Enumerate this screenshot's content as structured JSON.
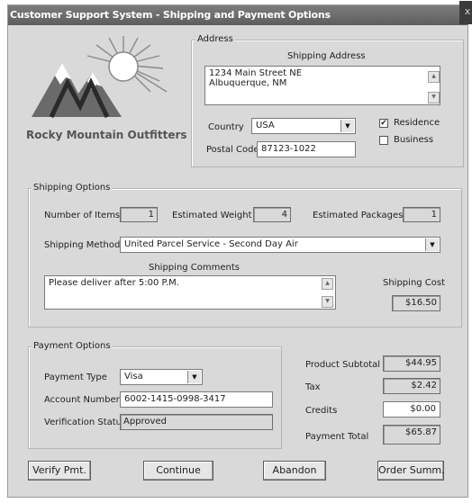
{
  "window": {
    "title": "Customer Support System - Shipping and Payment Options",
    "close_glyph": "x"
  },
  "logo": {
    "text": "Rocky Mountain Outfitters"
  },
  "address": {
    "group_title": "Address",
    "shipping_address_label": "Shipping Address",
    "shipping_address_value": "1234 Main Street  NE\nAlbuquerque, NM",
    "country_label": "Country",
    "country_value": "USA",
    "postal_code_label": "Postal Code",
    "postal_code_value": "87123-1022",
    "residence_label": "Residence",
    "residence_checked": true,
    "business_label": "Business",
    "business_checked": false
  },
  "shipping": {
    "group_title": "Shipping Options",
    "items_label": "Number of Items",
    "items_value": "1",
    "weight_label": "Estimated Weight",
    "weight_value": "4",
    "packages_label": "Estimated Packages",
    "packages_value": "1",
    "method_label": "Shipping Method",
    "method_value": "United Parcel Service - Second Day Air",
    "comments_label": "Shipping Comments",
    "comments_value": "Please deliver after 5:00 P.M.",
    "cost_label": "Shipping Cost",
    "cost_value": "$16.50"
  },
  "payment": {
    "group_title": "Payment Options",
    "type_label": "Payment Type",
    "type_value": "Visa",
    "account_label": "Account Number",
    "account_value": "6002-1415-0998-3417",
    "verification_label": "Verification Status",
    "verification_value": "Approved"
  },
  "totals": {
    "subtotal_label": "Product Subtotal",
    "subtotal_value": "$44.95",
    "tax_label": "Tax",
    "tax_value": "$2.42",
    "credits_label": "Credits",
    "credits_value": "$0.00",
    "total_label": "Payment Total",
    "total_value": "$65.87"
  },
  "buttons": {
    "verify": "Verify Pmt.",
    "continue": "Continue",
    "abandon": "Abandon",
    "order_summary": "Order Summ."
  },
  "icons": {
    "dropdown": "dropdown-arrow-icon",
    "scroll_up": "scroll-up-icon",
    "scroll_down": "scroll-down-icon",
    "checkmark": "checkmark-icon"
  }
}
